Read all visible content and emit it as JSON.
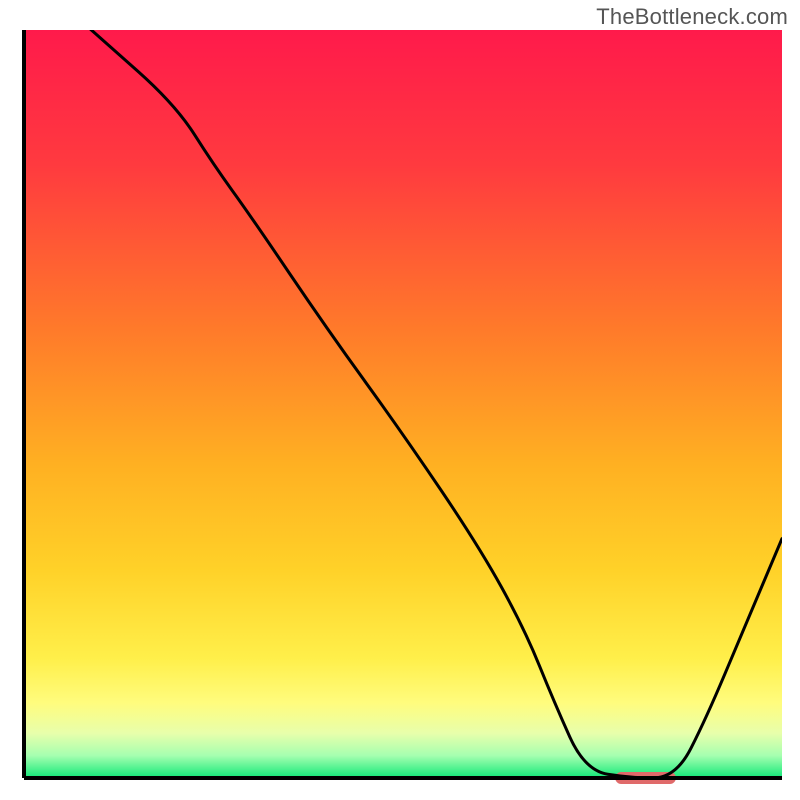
{
  "watermark": "TheBottleneck.com",
  "chart_data": {
    "type": "line",
    "title": "",
    "xlabel": "",
    "ylabel": "",
    "xlim": [
      0,
      100
    ],
    "ylim": [
      0,
      100
    ],
    "x": [
      0,
      10,
      20,
      25,
      30,
      40,
      50,
      60,
      66,
      70,
      74,
      80,
      86,
      90,
      95,
      100
    ],
    "values": [
      108,
      99,
      90,
      82,
      75,
      60,
      46,
      31,
      20,
      10,
      1,
      0,
      0,
      8,
      20,
      32
    ],
    "gradient_stops": [
      {
        "offset": 0,
        "color": "#ff1a4b"
      },
      {
        "offset": 18,
        "color": "#ff3a3f"
      },
      {
        "offset": 40,
        "color": "#ff7a2a"
      },
      {
        "offset": 58,
        "color": "#ffb022"
      },
      {
        "offset": 72,
        "color": "#ffd128"
      },
      {
        "offset": 84,
        "color": "#ffef4a"
      },
      {
        "offset": 90,
        "color": "#fffc7e"
      },
      {
        "offset": 94,
        "color": "#e8ffab"
      },
      {
        "offset": 97,
        "color": "#a6ffb0"
      },
      {
        "offset": 100,
        "color": "#10e878"
      }
    ],
    "marker": {
      "x_start": 78,
      "x_end": 86,
      "y": 0,
      "color": "#e06a6a"
    },
    "axis_color": "#000000",
    "line_color": "#000000"
  }
}
